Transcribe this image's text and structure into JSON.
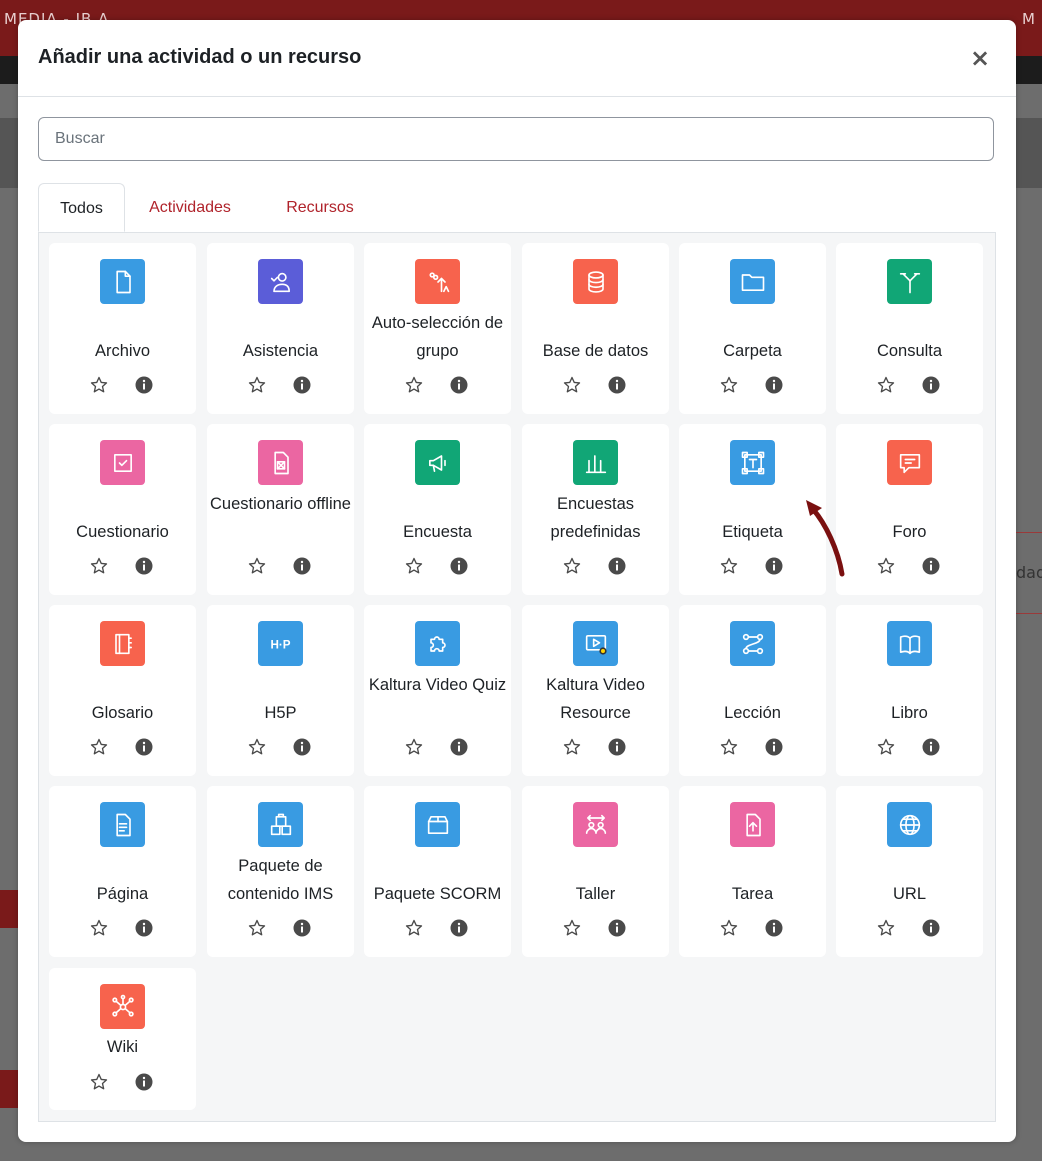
{
  "background": {
    "topbar_text": "MEDIA - IB A",
    "right_text": "M",
    "right_box_text": "dad"
  },
  "modal": {
    "title": "Añadir una actividad o un recurso",
    "close_label": "×",
    "search_placeholder": "Buscar",
    "search_value": "",
    "tabs": [
      {
        "label": "Todos",
        "active": true
      },
      {
        "label": "Actividades",
        "active": false
      },
      {
        "label": "Recursos",
        "active": false
      }
    ]
  },
  "colors": {
    "blue": "#399be2",
    "purple": "#5b5dd8",
    "red_orange": "#f7634d",
    "green": "#11a676",
    "pink": "#eb66a2",
    "accent_text": "#b0232b",
    "annotation_arrow": "#7a1010"
  },
  "activities": [
    {
      "label": "Archivo",
      "icon": "file-icon",
      "color": "#399be2"
    },
    {
      "label": "Asistencia",
      "icon": "attendance-icon",
      "color": "#5b5dd8"
    },
    {
      "label": "Auto-selección de grupo",
      "icon": "group-select-icon",
      "color": "#f7634d"
    },
    {
      "label": "Base de datos",
      "icon": "database-icon",
      "color": "#f7634d"
    },
    {
      "label": "Carpeta",
      "icon": "folder-icon",
      "color": "#399be2"
    },
    {
      "label": "Consulta",
      "icon": "choice-icon",
      "color": "#11a676"
    },
    {
      "label": "Cuestionario",
      "icon": "quiz-icon",
      "color": "#eb66a2"
    },
    {
      "label": "Cuestionario offline",
      "icon": "offline-quiz-icon",
      "color": "#eb66a2"
    },
    {
      "label": "Encuesta",
      "icon": "survey-icon",
      "color": "#11a676"
    },
    {
      "label": "Encuestas predefinidas",
      "icon": "bar-chart-icon",
      "color": "#11a676"
    },
    {
      "label": "Etiqueta",
      "icon": "text-label-icon",
      "color": "#399be2"
    },
    {
      "label": "Foro",
      "icon": "forum-icon",
      "color": "#f7634d"
    },
    {
      "label": "Glosario",
      "icon": "glossary-icon",
      "color": "#f7634d"
    },
    {
      "label": "H5P",
      "icon": "h5p-icon",
      "color": "#399be2"
    },
    {
      "label": "Kaltura Video Quiz",
      "icon": "puzzle-icon",
      "color": "#399be2"
    },
    {
      "label": "Kaltura Video Resource",
      "icon": "video-icon",
      "color": "#399be2"
    },
    {
      "label": "Lección",
      "icon": "lesson-icon",
      "color": "#399be2"
    },
    {
      "label": "Libro",
      "icon": "book-icon",
      "color": "#399be2"
    },
    {
      "label": "Página",
      "icon": "page-icon",
      "color": "#399be2"
    },
    {
      "label": "Paquete de contenido IMS",
      "icon": "ims-package-icon",
      "color": "#399be2"
    },
    {
      "label": "Paquete SCORM",
      "icon": "scorm-package-icon",
      "color": "#399be2"
    },
    {
      "label": "Taller",
      "icon": "workshop-icon",
      "color": "#eb66a2"
    },
    {
      "label": "Tarea",
      "icon": "assignment-icon",
      "color": "#eb66a2"
    },
    {
      "label": "URL",
      "icon": "globe-icon",
      "color": "#399be2"
    },
    {
      "label": "Wiki",
      "icon": "wiki-icon",
      "color": "#f7634d"
    }
  ]
}
